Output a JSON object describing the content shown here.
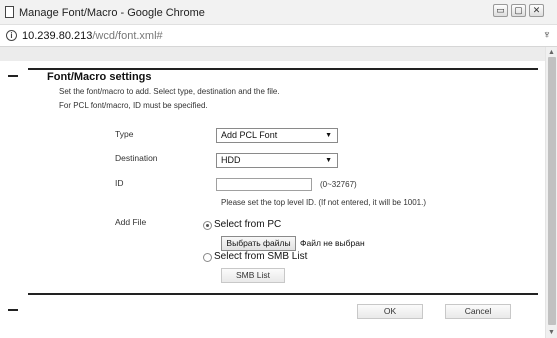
{
  "window": {
    "title": "Manage Font/Macro - Google Chrome",
    "controls": {
      "minimize": "▭",
      "maximize": "▢",
      "close": "✕"
    }
  },
  "address_bar": {
    "host": "10.239.80.213",
    "path": "/wcd/font.xml#"
  },
  "page": {
    "heading": "Font/Macro settings",
    "description_1": "Set the font/macro to add. Select type, destination and the file.",
    "description_2": "For PCL font/macro, ID must be specified.",
    "type": {
      "label": "Type",
      "value": "Add PCL Font"
    },
    "destination": {
      "label": "Destination",
      "value": "HDD"
    },
    "id": {
      "label": "ID",
      "value": "",
      "range": "(0~32767)",
      "hint": "Please set the top level ID. (If not entered, it will be 1001.)"
    },
    "add_file": {
      "label": "Add File",
      "option_pc": "Select from PC",
      "choose_button": "Выбрать файлы",
      "file_status": "Файл не выбран",
      "option_smb": "Select from SMB List",
      "smb_button": "SMB List",
      "selected": "pc"
    },
    "ok_button": "OK",
    "cancel_button": "Cancel"
  },
  "icons": {
    "page": "page-icon",
    "info": "info-icon",
    "extension": "puzzle-icon",
    "dropdown": "chevron-down-icon"
  }
}
